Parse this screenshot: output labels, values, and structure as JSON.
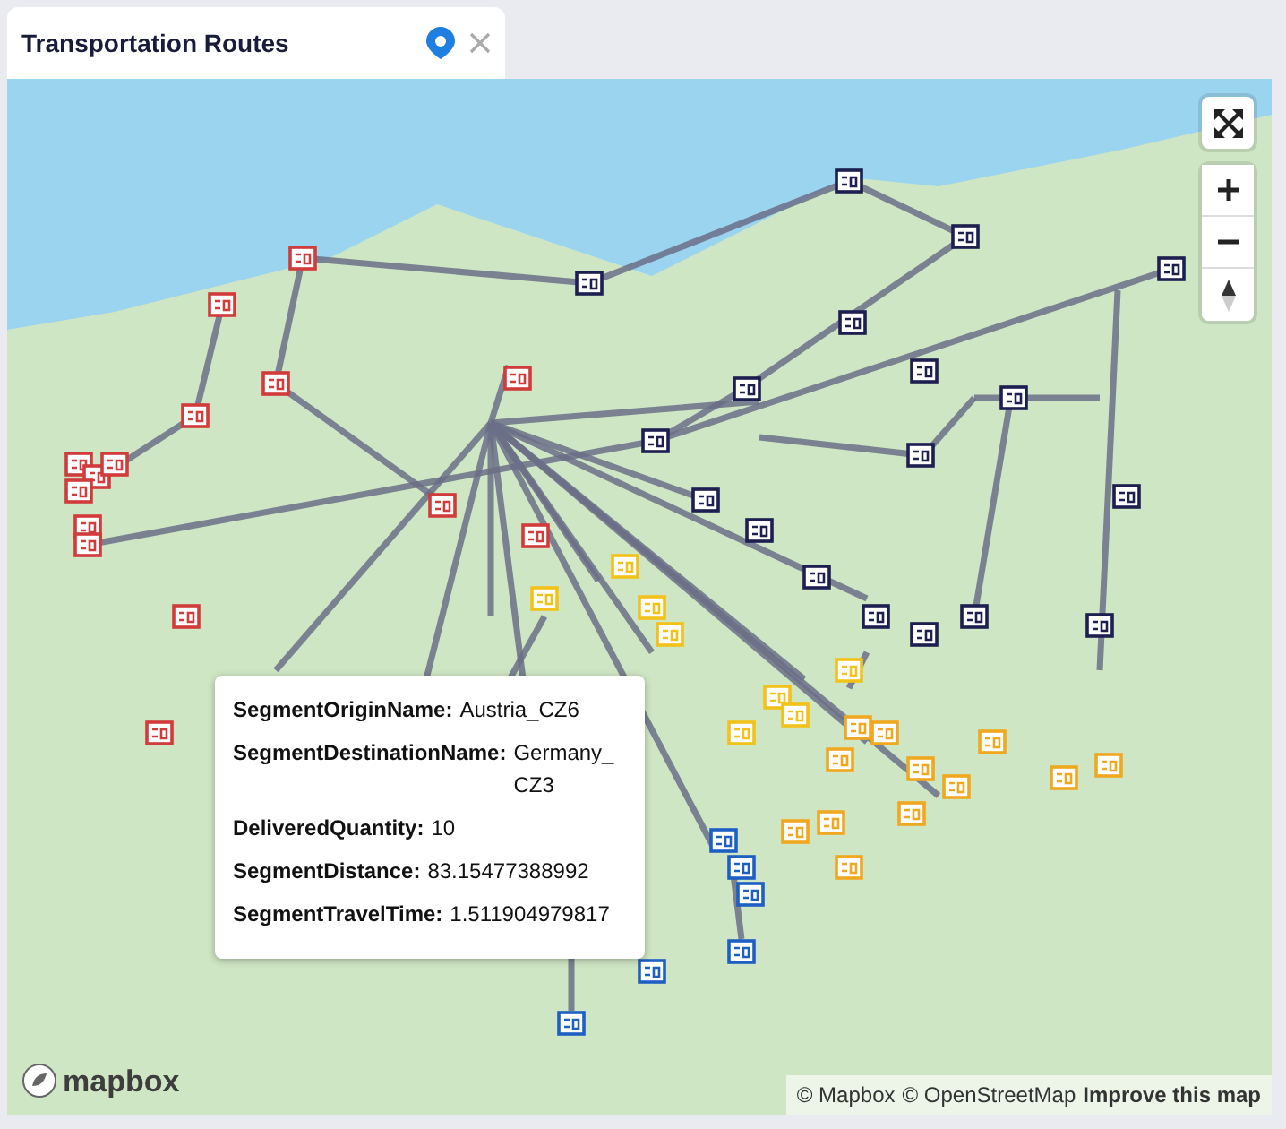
{
  "panel": {
    "title": "Transportation Routes"
  },
  "marker_groups": [
    {
      "color": "#d13b3b"
    },
    {
      "color": "#1c1f4f"
    },
    {
      "color": "#f2c21a"
    },
    {
      "color": "#f0a820"
    },
    {
      "color": "#1e5fc4"
    }
  ],
  "tooltip": {
    "fields": [
      {
        "label": "SegmentOriginName:",
        "value": "Austria_CZ6"
      },
      {
        "label": "SegmentDestinationName:",
        "value": "Germany_ CZ3"
      },
      {
        "label": "DeliveredQuantity:",
        "value": "10"
      },
      {
        "label": "SegmentDistance:",
        "value": "83.15477388992"
      },
      {
        "label": "SegmentTravelTime:",
        "value": "1.511904979817"
      }
    ]
  },
  "logo": "mapbox",
  "attribution": [
    {
      "text": "© Mapbox",
      "kind": "link"
    },
    {
      "text": "© OpenStreetMap",
      "kind": "link"
    },
    {
      "text": "Improve this map",
      "kind": "strong"
    }
  ]
}
